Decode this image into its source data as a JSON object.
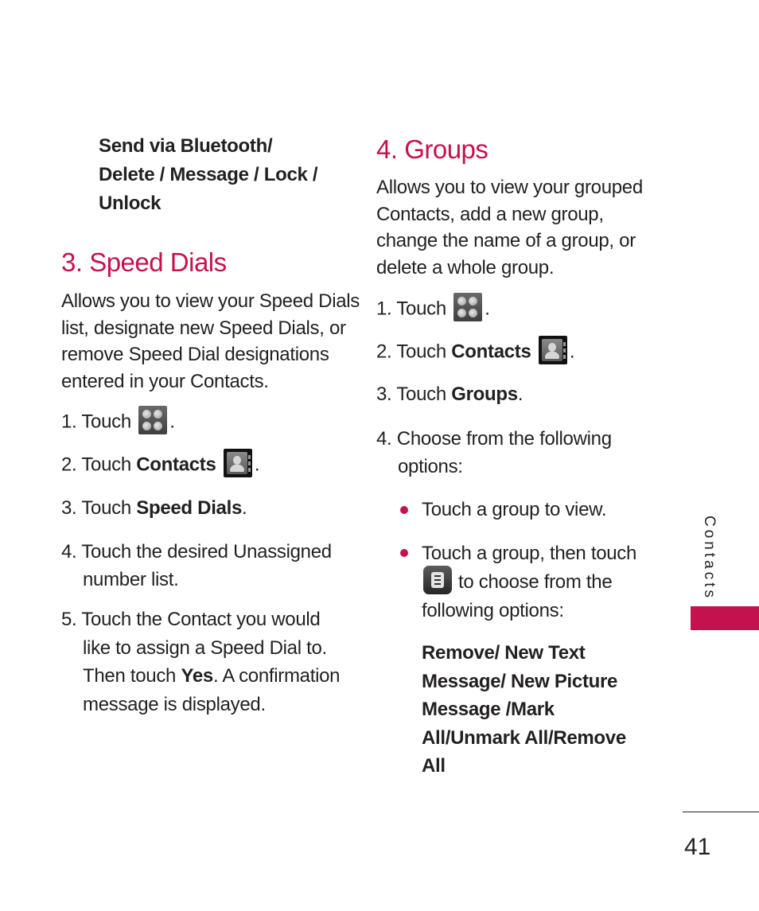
{
  "left_column": {
    "continued_options": [
      "Send via Bluetooth/",
      "Delete / Message / Lock /",
      "Unlock"
    ],
    "speed_dials": {
      "heading": "3. Speed Dials",
      "description": [
        "Allows you to view your Speed Dials",
        "list, designate new Speed Dials, or",
        "remove Speed Dial designations",
        "entered in your Contacts."
      ],
      "steps": {
        "s1": {
          "prefix": "1. Touch",
          "suffix": ".",
          "icon": "apps-grid-icon"
        },
        "s2": {
          "prefix": "2. Touch ",
          "bold": "Contacts",
          "suffix": ".",
          "icon": "contacts-book-icon"
        },
        "s3": {
          "prefix": "3. Touch ",
          "bold": "Speed Dials",
          "suffix": "."
        },
        "s4": {
          "lines": [
            "4. Touch the desired Unassigned",
            "number list."
          ]
        },
        "s5": {
          "line1": "5. Touch the Contact you would",
          "line2": "like to assign a Speed Dial to.",
          "line3_prefix": "Then touch ",
          "line3_bold": "Yes",
          "line3_suffix": ". A confirmation",
          "line4": "message is displayed."
        }
      }
    }
  },
  "right_column": {
    "groups": {
      "heading": "4. Groups",
      "description": [
        "Allows you to view your grouped",
        "Contacts, add a new group,",
        "change the name of a group, or",
        "delete a whole group."
      ],
      "steps": {
        "s1": {
          "prefix": "1. Touch",
          "suffix": ".",
          "icon": "apps-grid-icon"
        },
        "s2": {
          "prefix": "2. Touch ",
          "bold": "Contacts",
          "suffix": ".",
          "icon": "contacts-book-icon"
        },
        "s3": {
          "prefix": "3. Touch ",
          "bold": "Groups",
          "suffix": "."
        },
        "s4": {
          "lines": [
            "4. Choose from the following",
            "options:"
          ]
        }
      },
      "bullets": {
        "b1": "Touch a group to view.",
        "b2_line1": "Touch a group, then touch",
        "b2_line2": "to choose from the",
        "b2_line3": "following options:",
        "b2_icon": "menu-icon"
      },
      "options": [
        "Remove/ New Text",
        "Message/ New Picture",
        "Message /Mark",
        "All/Unmark All/Remove",
        "All"
      ]
    }
  },
  "sidebar": {
    "section_label": "Contacts",
    "accent_color": "#c4124f"
  },
  "footer": {
    "page_number": "41"
  }
}
